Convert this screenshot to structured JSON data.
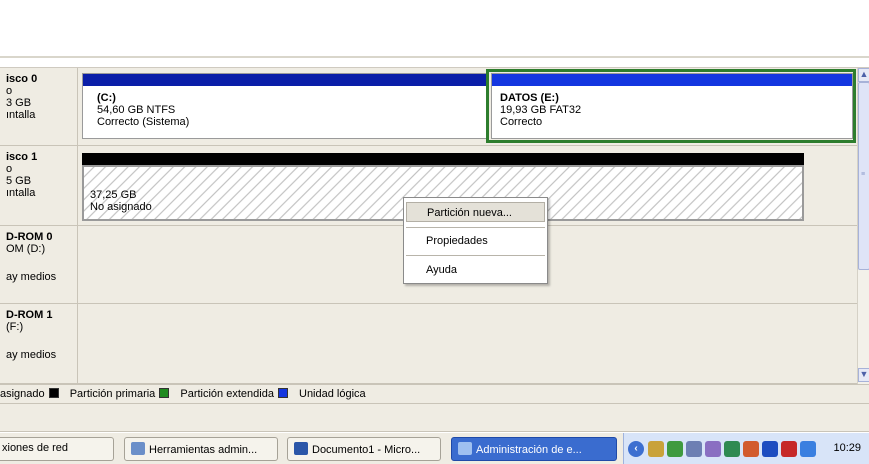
{
  "disks": [
    {
      "name": "isco 0",
      "line2": "o",
      "size": "3 GB",
      "status": "ıntalla",
      "partitions": [
        {
          "title": "(C:)",
          "size_fs": "54,60 GB NTFS",
          "health": "Correcto (Sistema)",
          "bar_color": "#0a1ea8"
        },
        {
          "title": "DATOS  (E:)",
          "size_fs": "19,93 GB FAT32",
          "health": "Correcto",
          "bar_color": "#1436e0"
        }
      ]
    },
    {
      "name": "isco 1",
      "line2": "o",
      "size": "5 GB",
      "status": "ıntalla",
      "unallocated": {
        "size": "37,25 GB",
        "label": "No asignado",
        "bar_color": "#000000"
      }
    },
    {
      "name": "D-ROM 0",
      "line2": "OM (D:)",
      "status": "ay medios"
    },
    {
      "name": "D-ROM 1",
      "line2": "(F:)",
      "status": "ay medios"
    }
  ],
  "context_menu": {
    "items": [
      "Partición nueva...",
      "Propiedades",
      "Ayuda"
    ]
  },
  "legend": [
    {
      "label": "asignado",
      "color": "#000000"
    },
    {
      "label": "Partición primaria",
      "color": "#0a1ea8"
    },
    {
      "label": "Partición extendida",
      "color": "#1f8a1f"
    },
    {
      "label": "Unidad lógica",
      "color": "#1436e0"
    }
  ],
  "taskbar": {
    "tasks": [
      {
        "label": "xiones de red",
        "icon": "network-icon"
      },
      {
        "label": "Herramientas admin...",
        "icon": "admin-tools-icon"
      },
      {
        "label": "Documento1 - Micro...",
        "icon": "word-document-icon"
      },
      {
        "label": "Administración de e...",
        "icon": "computer-management-icon"
      }
    ],
    "clock": "10:29"
  },
  "colors": {
    "selected_border": "#2d7d2d",
    "active_task": "#3a6ccf"
  }
}
